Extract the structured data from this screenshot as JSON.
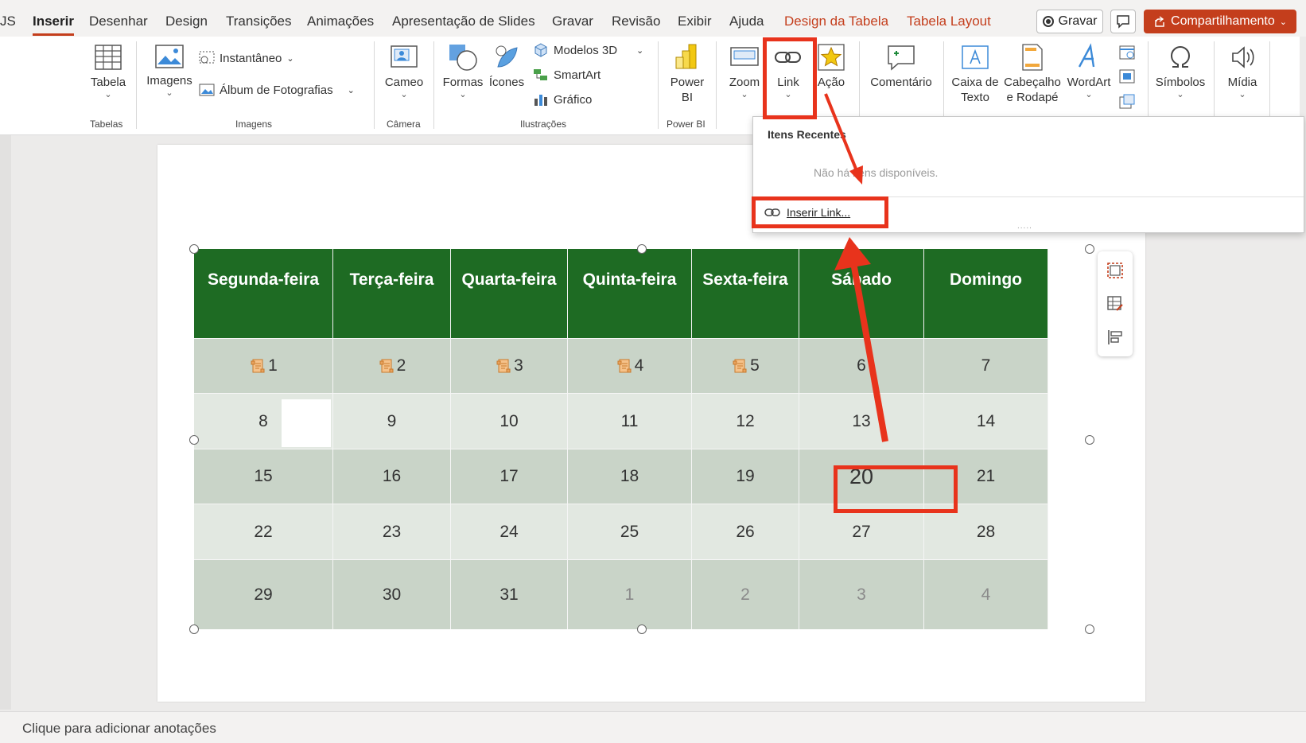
{
  "tabs": {
    "cut_prefix": "JS",
    "items": [
      "Inserir",
      "Desenhar",
      "Design",
      "Transições",
      "Animações",
      "Apresentação de Slides",
      "Gravar",
      "Revisão",
      "Exibir",
      "Ajuda",
      "Design da Tabela",
      "Tabela Layout"
    ],
    "active": "Inserir"
  },
  "top_right": {
    "record_label": "Gravar",
    "share_label": "Compartilhamento"
  },
  "ribbon": {
    "table_label": "Tabela",
    "images_label": "Imagens",
    "snapshot_label": "Instantâneo",
    "album_label": "Álbum de Fotografias",
    "cameo_label": "Cameo",
    "shapes_label": "Formas",
    "icons_label": "Ícones",
    "models3d_label": "Modelos 3D",
    "smartart_label": "SmartArt",
    "chart_label": "Gráfico",
    "powerbi_label1": "Power",
    "powerbi_label2": "BI",
    "zoom_label": "Zoom",
    "link_label": "Link",
    "action_label": "Ação",
    "comment_label": "Comentário",
    "textbox_label1": "Caixa de",
    "textbox_label2": "Texto",
    "headerfooter_label1": "Cabeçalho",
    "headerfooter_label2": "e Rodapé",
    "wordart_label": "WordArt",
    "symbols_label": "Símbolos",
    "media_label": "Mídia",
    "groups": {
      "tables": "Tabelas",
      "images": "Imagens",
      "camera": "Câmera",
      "illustrations": "Ilustrações",
      "powerbi": "Power BI"
    }
  },
  "dropdown": {
    "title": "Itens Recentes",
    "empty": "Não há itens disponíveis.",
    "insert_link": "Inserir Link...",
    "grip": "....."
  },
  "calendar": {
    "headers": [
      "Segunda-feira",
      "Terça-feira",
      "Quarta-feira",
      "Quinta-feira",
      "Sexta-feira",
      "Sábado",
      "Domingo"
    ],
    "rows": [
      [
        "1",
        "2",
        "3",
        "4",
        "5",
        "6",
        "7"
      ],
      [
        "8",
        "9",
        "10",
        "11",
        "12",
        "13",
        "14"
      ],
      [
        "15",
        "16",
        "17",
        "18",
        "19",
        "20",
        "21"
      ],
      [
        "22",
        "23",
        "24",
        "25",
        "26",
        "27",
        "28"
      ],
      [
        "29",
        "30",
        "31",
        "1",
        "2",
        "3",
        "4"
      ]
    ],
    "header_bg": "#1e6b23"
  },
  "notes_placeholder": "Clique para adicionar anotações",
  "colors": {
    "accent": "#c43e1c",
    "annotation_red": "#e8331c"
  }
}
